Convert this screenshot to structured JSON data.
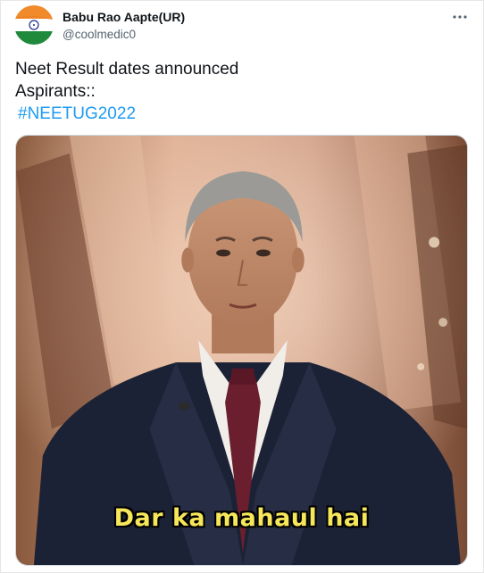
{
  "tweet": {
    "author_name": "Babu Rao Aapte(UR)",
    "author_handle": "@coolmedic0",
    "lines": [
      "Neet Result dates announced",
      "Aspirants::"
    ],
    "hashtag": "#NEETUG2022",
    "more_icon": "more-horizontal-icon",
    "avatar_icon": "indian-flag-avatar"
  },
  "media": {
    "caption": "Dar ka mahaul hai"
  },
  "colors": {
    "link": "#1d9bf0",
    "text": "#0f1419",
    "secondary": "#536471",
    "caption": "#f6e75a"
  }
}
